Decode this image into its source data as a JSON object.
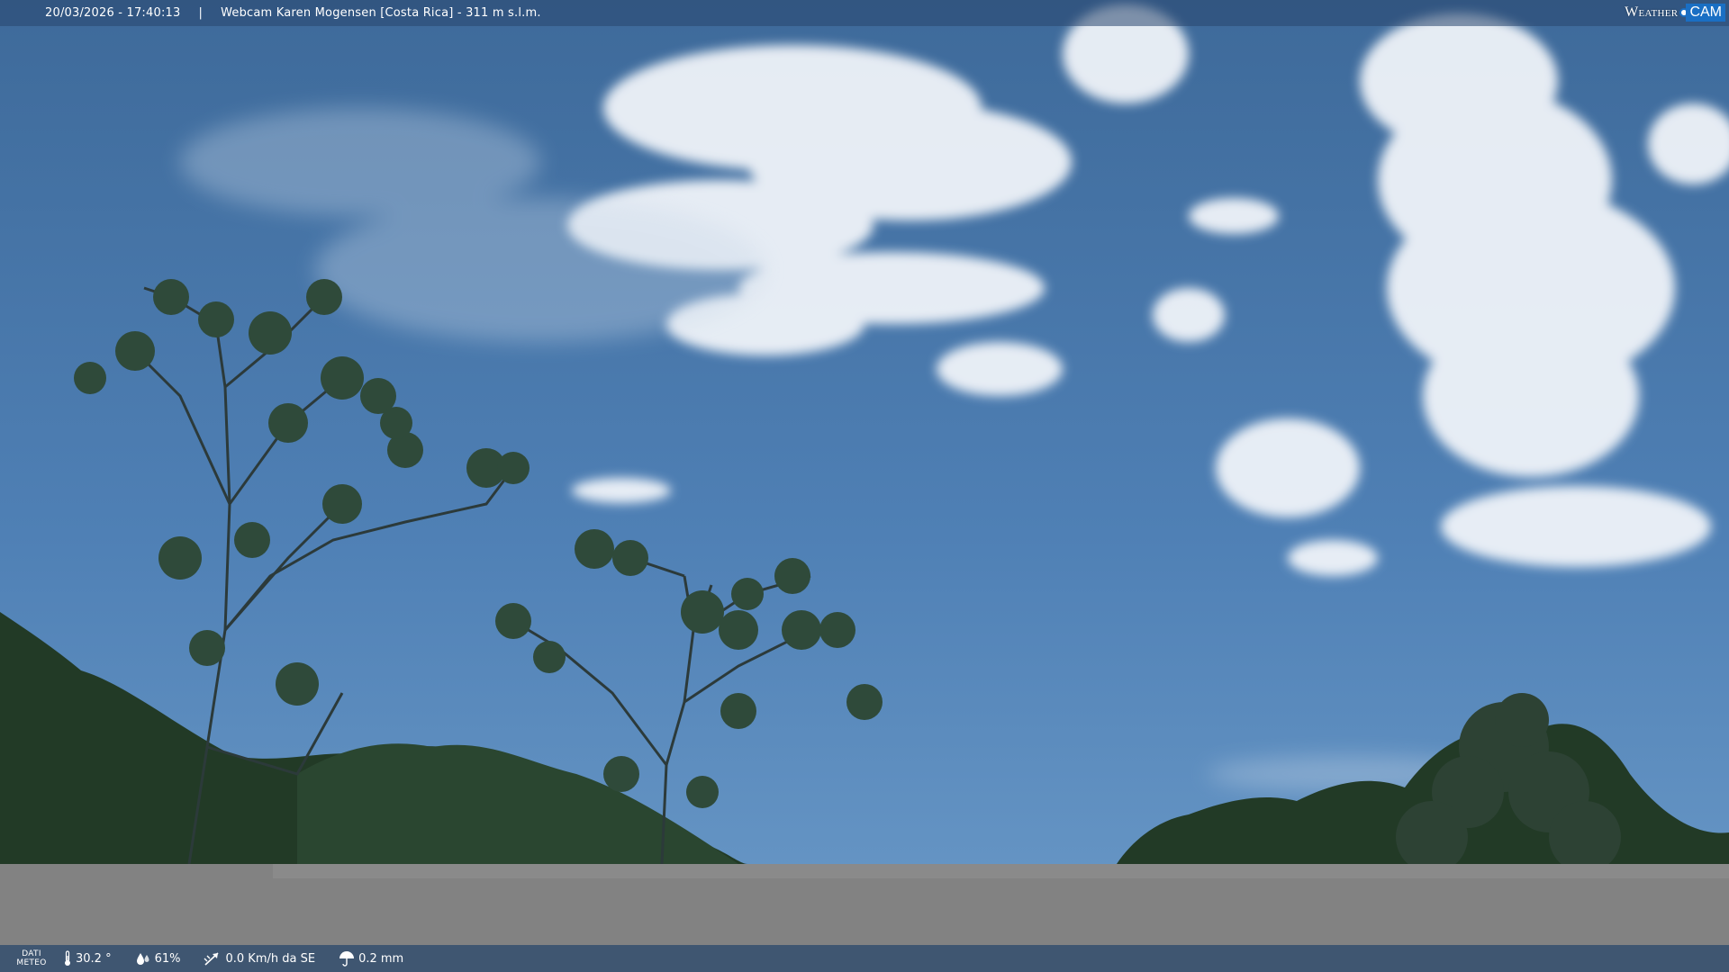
{
  "header": {
    "timestamp": "20/03/2026 - 17:40:13",
    "separator": "|",
    "title": "Webcam Karen Mogensen [Costa Rica]  - 311 m s.l.m."
  },
  "logo": {
    "weather_text": "Weather",
    "cam_text": "CAM"
  },
  "footer": {
    "dati_line1": "DATI",
    "dati_line2": "METEO",
    "temperature": "30.2 °",
    "humidity": "61%",
    "wind": "0.0 Km/h da SE",
    "rain": "0.2 mm"
  },
  "colors": {
    "sky_top": "#3e6a9a",
    "sky_bottom": "#5e8fc0",
    "gray_overlay": "#828282",
    "bar": "#3c5069",
    "logo_accent": "#1a6fc4"
  }
}
